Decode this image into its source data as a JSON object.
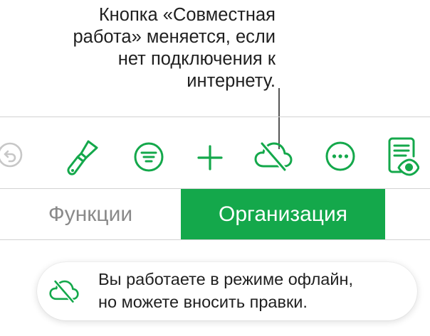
{
  "callout": {
    "lines": [
      "Кнопка «Совместная",
      "работа» меняется, если",
      "нет подключения к",
      "интернету."
    ]
  },
  "toolbar": {
    "buttons": [
      {
        "icon": "undo-icon",
        "state": "disabled"
      },
      {
        "icon": "paintbrush-icon"
      },
      {
        "icon": "organize-filter-icon"
      },
      {
        "icon": "plus-icon"
      },
      {
        "icon": "cloud-offline-icon"
      },
      {
        "icon": "more-icon"
      },
      {
        "icon": "reading-view-icon"
      }
    ]
  },
  "tabs": [
    {
      "label": "Функции",
      "selected": false
    },
    {
      "label": "Организация",
      "selected": true
    }
  ],
  "banner": {
    "icon": "cloud-offline-icon",
    "line1": "Вы работаете в режиме офлайн,",
    "line2": "но можете вносить правки."
  },
  "colors": {
    "accent": "#14a84b",
    "disabled": "#c7c7c7",
    "text": "#1f1f1f",
    "inactive_tab": "#8a8a8a"
  }
}
